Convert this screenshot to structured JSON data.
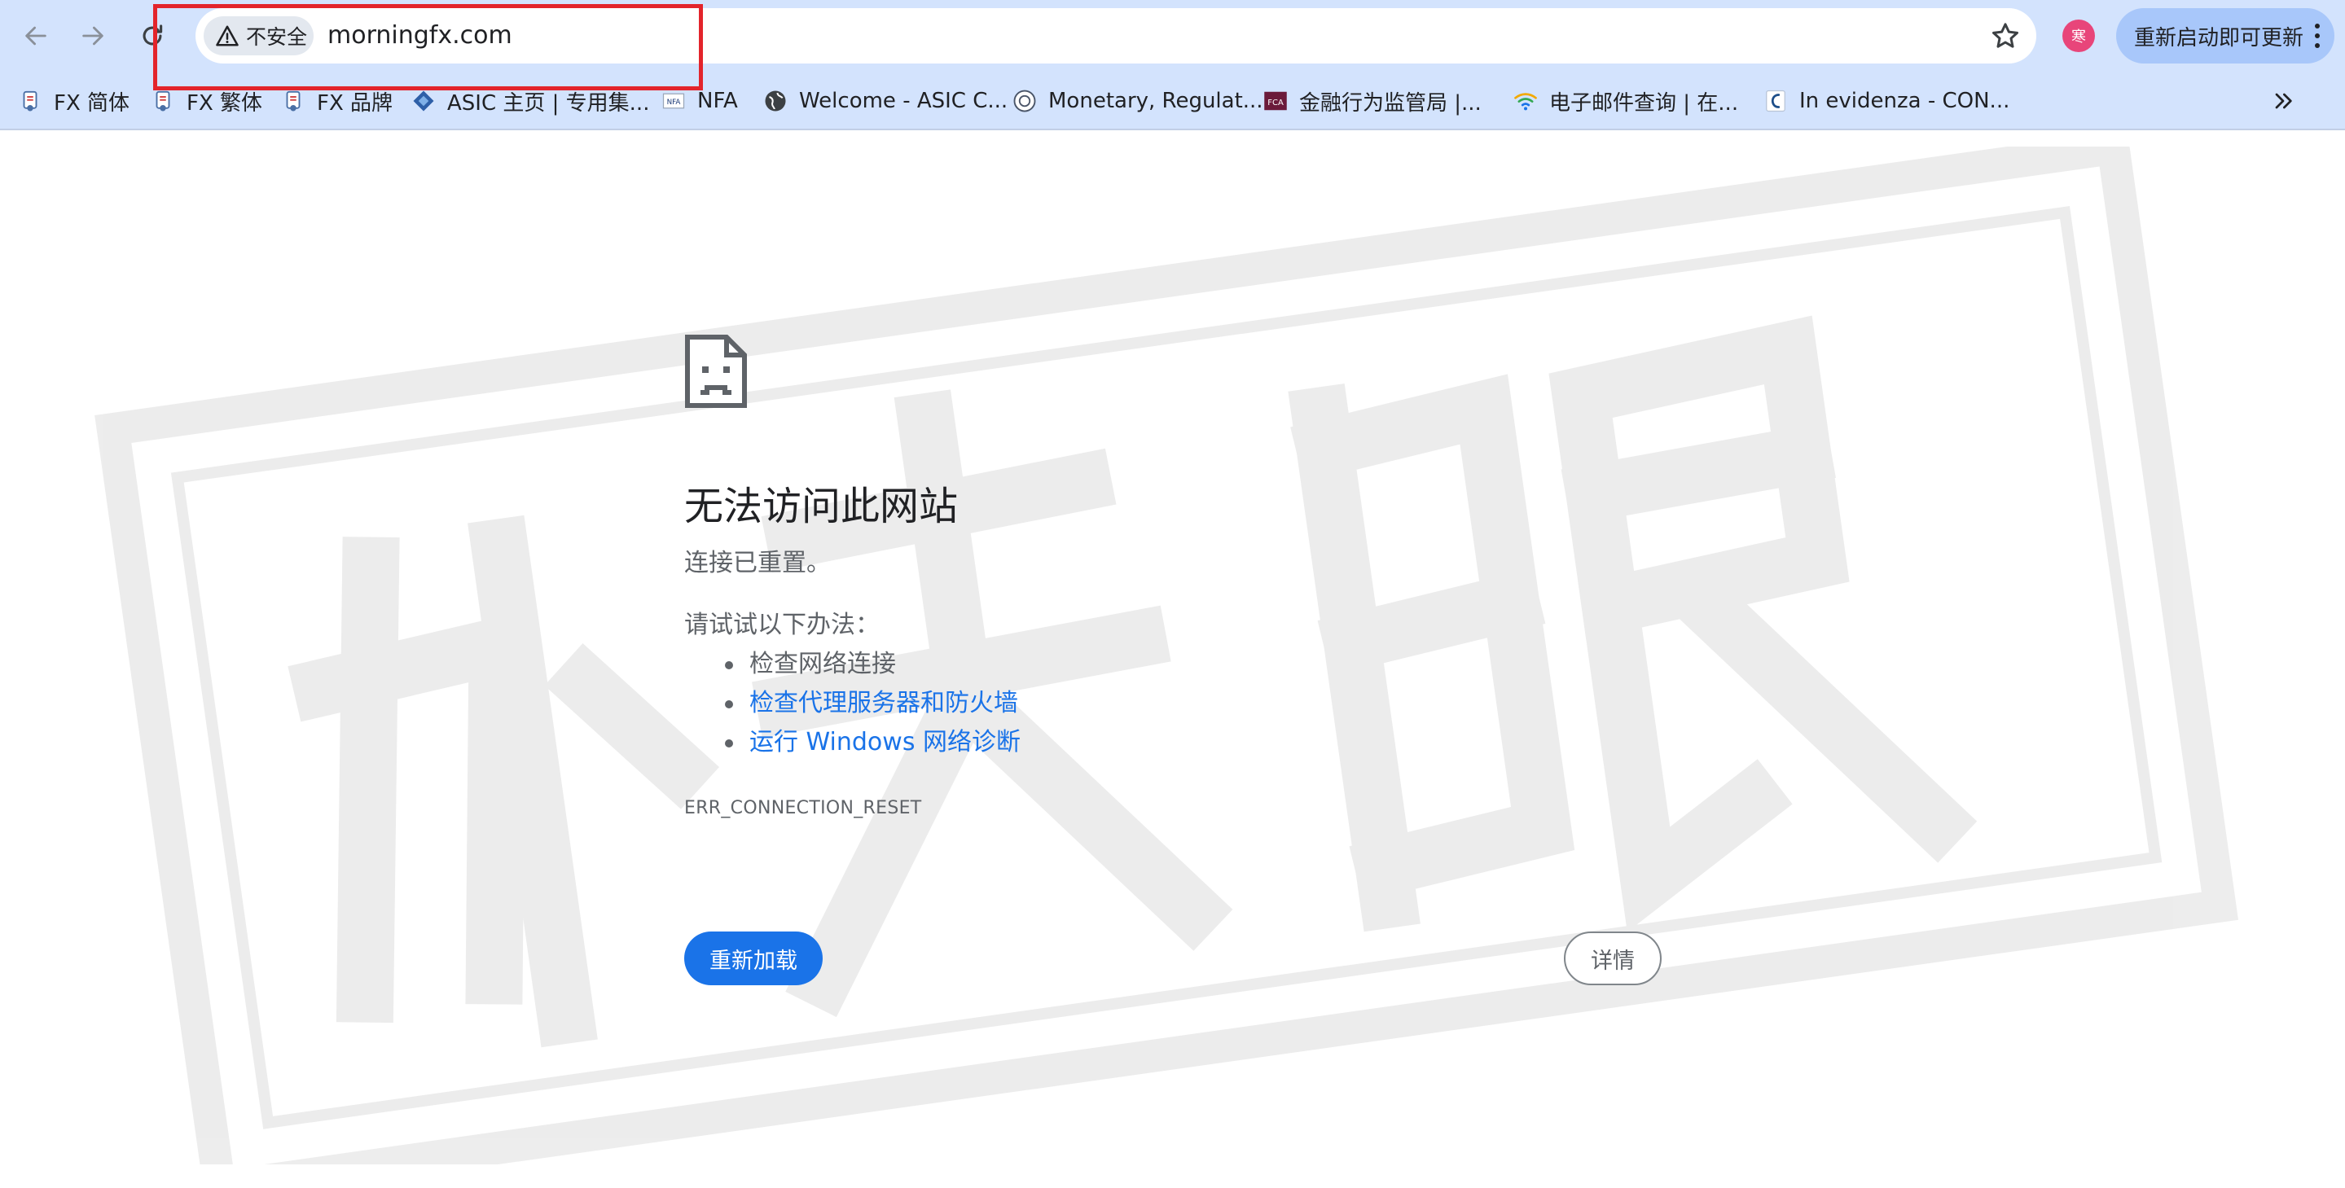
{
  "omnibox": {
    "security_label": "不安全",
    "url": "morningfx.com"
  },
  "profile": {
    "avatar_text": "寒"
  },
  "update_button": {
    "label": "重新启动即可更新"
  },
  "bookmarks": [
    {
      "label": "FX 简体",
      "icon": "fx-favicon-icon"
    },
    {
      "label": "FX 繁体",
      "icon": "fx-favicon-icon"
    },
    {
      "label": "FX 品牌",
      "icon": "fx-favicon-icon"
    },
    {
      "label": "ASIC 主页 | 专用集...",
      "icon": "asic-diamond-icon"
    },
    {
      "label": "NFA",
      "icon": "nfa-favicon-icon"
    },
    {
      "label": "Welcome - ASIC C...",
      "icon": "globe-icon"
    },
    {
      "label": "Monetary, Regulat...",
      "icon": "seal-icon"
    },
    {
      "label": "金融行为监管局 |...",
      "icon": "fca-favicon-icon"
    },
    {
      "label": "电子邮件查询 | 在...",
      "icon": "wifi-favicon-icon"
    },
    {
      "label": "In evidenza - CON...",
      "icon": "consob-favicon-icon"
    }
  ],
  "error": {
    "title": "无法访问此网站",
    "subtitle": "连接已重置。",
    "try_heading": "请试试以下办法：",
    "suggestions": [
      {
        "text": "检查网络连接",
        "link": false
      },
      {
        "text": "检查代理服务器和防火墙",
        "link": true
      },
      {
        "text": "运行 Windows 网络诊断",
        "link": true
      }
    ],
    "code": "ERR_CONNECTION_RESET",
    "reload_label": "重新加载",
    "details_label": "详情"
  },
  "colors": {
    "toolbar_bg": "#d3e3fd",
    "accent_blue": "#1a73e8",
    "highlight_red": "#e3242b",
    "avatar_pink": "#e8457a",
    "update_pill": "#a8c7fa"
  }
}
